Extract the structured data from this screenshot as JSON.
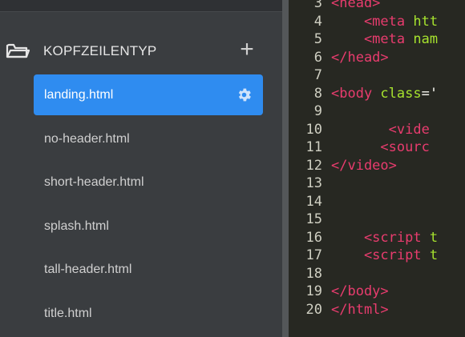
{
  "sidebar": {
    "folder": {
      "title": "KOPFZEILENTYP",
      "icon": "folder-icon",
      "add_icon": "plus-icon",
      "add_label": "+"
    },
    "files": [
      {
        "label": "landing.html",
        "active": true,
        "icon": "gear-icon"
      },
      {
        "label": "no-header.html",
        "active": false
      },
      {
        "label": "short-header.html",
        "active": false
      },
      {
        "label": "splash.html",
        "active": false
      },
      {
        "label": "tall-header.html",
        "active": false
      },
      {
        "label": "title.html",
        "active": false
      }
    ]
  },
  "colors": {
    "accent": "#2f8cf0",
    "sidebar_bg": "#3a3d40",
    "editor_bg": "#272822",
    "tag": "#e83c6e",
    "attr": "#a6e22e",
    "string": "#e6db74"
  },
  "editor": {
    "lines": [
      {
        "num": "3",
        "tag": "<head>",
        "attr": "",
        "rest": ""
      },
      {
        "num": "4",
        "tag": "    <meta ",
        "attr": "htt",
        "rest": ""
      },
      {
        "num": "5",
        "tag": "    <meta ",
        "attr": "nam",
        "rest": ""
      },
      {
        "num": "6",
        "tag": "</head>",
        "attr": "",
        "rest": ""
      },
      {
        "num": "7",
        "tag": "",
        "attr": "",
        "rest": ""
      },
      {
        "num": "8",
        "tag": "<body ",
        "attr": "class",
        "rest": "='"
      },
      {
        "num": "9",
        "tag": "",
        "attr": "",
        "rest": ""
      },
      {
        "num": "10",
        "tag": "       <vide",
        "attr": "",
        "rest": ""
      },
      {
        "num": "11",
        "tag": "      <sourc",
        "attr": "",
        "rest": ""
      },
      {
        "num": "12",
        "tag": "</video>",
        "attr": "",
        "rest": ""
      },
      {
        "num": "13",
        "tag": "",
        "attr": "",
        "rest": ""
      },
      {
        "num": "14",
        "tag": "",
        "attr": "",
        "rest": ""
      },
      {
        "num": "15",
        "tag": "",
        "attr": "",
        "rest": ""
      },
      {
        "num": "16",
        "tag": "    <script ",
        "attr": "t",
        "rest": ""
      },
      {
        "num": "17",
        "tag": "    <script ",
        "attr": "t",
        "rest": ""
      },
      {
        "num": "18",
        "tag": "",
        "attr": "",
        "rest": ""
      },
      {
        "num": "19",
        "tag": "</body>",
        "attr": "",
        "rest": ""
      },
      {
        "num": "20",
        "tag": "</html>",
        "attr": "",
        "rest": ""
      }
    ]
  }
}
